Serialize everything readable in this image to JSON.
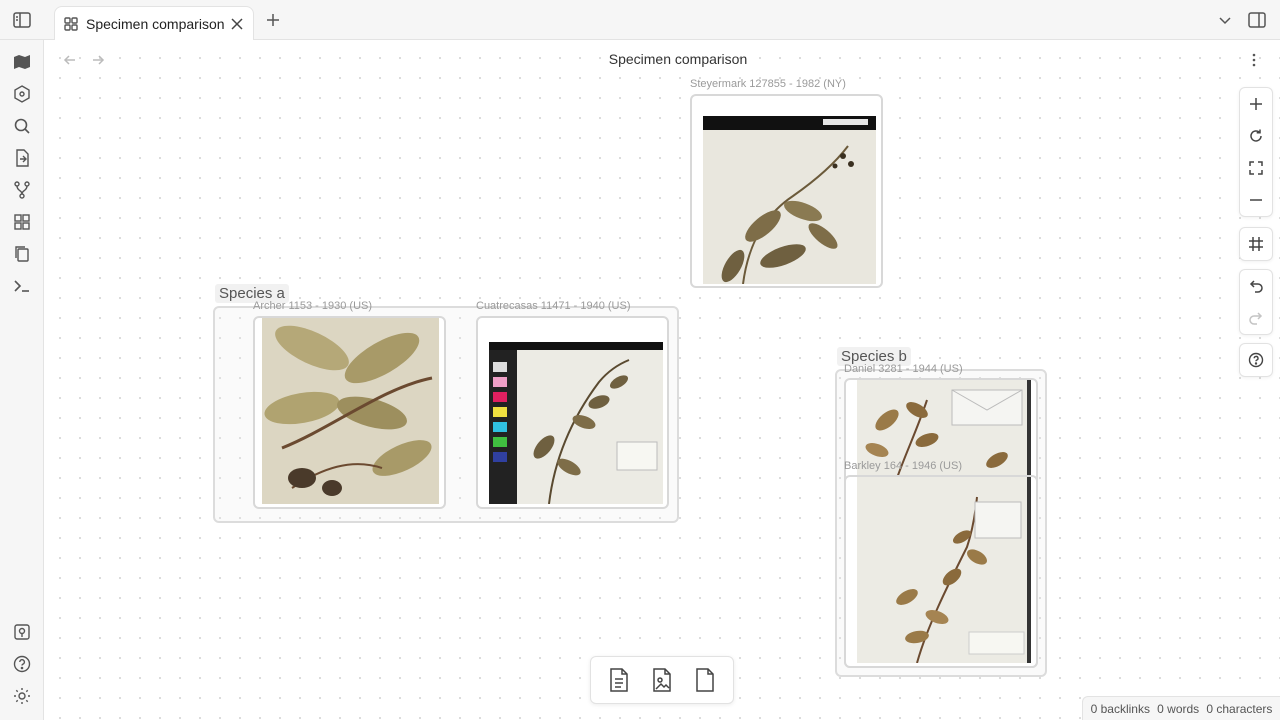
{
  "tab": {
    "title": "Specimen comparison",
    "icon": "canvas-grid-icon"
  },
  "view": {
    "title": "Specimen comparison"
  },
  "ribbon": {
    "items": [
      "map-icon",
      "graph-icon",
      "search-icon",
      "file-switch-icon",
      "git-branch-icon",
      "grid-icon",
      "copy-icon",
      "terminal-icon"
    ],
    "bottom": [
      "vault-icon",
      "help-icon",
      "settings-icon"
    ]
  },
  "canvas_controls": [
    "zoom-in",
    "reset-zoom",
    "fit-view",
    "zoom-out",
    "snap-grid",
    "undo",
    "redo",
    "help"
  ],
  "groups": {
    "species_a": {
      "label": "Species a"
    },
    "species_b": {
      "label": "Species b"
    }
  },
  "nodes": {
    "steyermark": {
      "label": "Steyermark 127855 - 1982 (NY)"
    },
    "archer": {
      "label": "Archer 1153 - 1930 (US)"
    },
    "cuatrecasas": {
      "label": "Cuatrecasas 11471 - 1940 (US)"
    },
    "daniel": {
      "label": "Daniel 3281 - 1944 (US)"
    },
    "barkley": {
      "label": "Barkley 164 - 1946 (US)"
    }
  },
  "card_toolbar": [
    "add-note-card",
    "add-media-card",
    "add-blank-card"
  ],
  "status": {
    "backlinks": "0 backlinks",
    "words": "0 words",
    "characters": "0 characters"
  },
  "colors": {
    "accent": "#7a6fd6",
    "group_border": "#dcdcdc",
    "herbarium_paper": "#ece9df",
    "leaf": "#8a7a4e"
  }
}
